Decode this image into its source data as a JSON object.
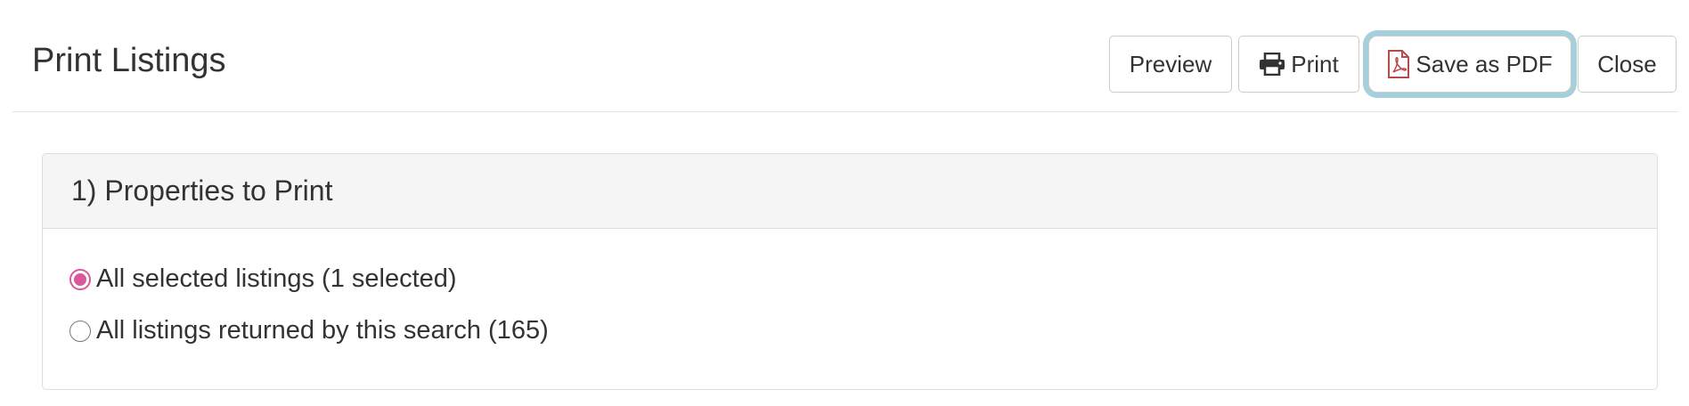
{
  "header": {
    "title": "Print Listings"
  },
  "toolbar": {
    "preview_label": "Preview",
    "print_label": "Print",
    "print_icon": "printer-icon",
    "save_pdf_label": "Save as PDF",
    "save_pdf_icon": "pdf-file-icon",
    "close_label": "Close",
    "focused_button": "Save as PDF",
    "focus_ring_color": "#a6cfdc",
    "pdf_icon_color": "#b94a48"
  },
  "section": {
    "title": "1) Properties to Print",
    "options": [
      {
        "label": "All selected listings (1 selected)",
        "checked": true
      },
      {
        "label": "All listings returned by this search (165)",
        "checked": false
      }
    ],
    "accent_color": "#d9589c"
  }
}
